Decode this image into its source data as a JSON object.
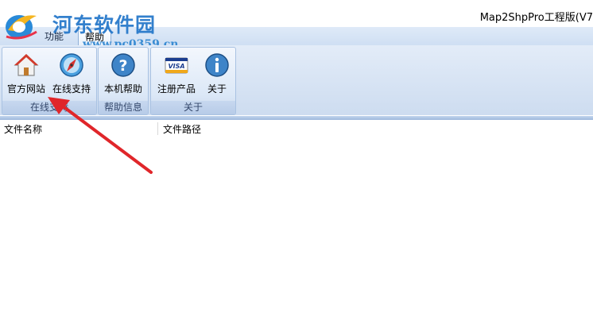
{
  "window": {
    "title": "Map2ShpPro工程版(V7"
  },
  "watermark": {
    "site_name": "河东软件园",
    "url": "www.pc0359.cn"
  },
  "tabs": [
    {
      "label": "功能"
    },
    {
      "label": "帮助",
      "active": true
    }
  ],
  "ribbon": {
    "groups": [
      {
        "label": "在线支持",
        "buttons": [
          {
            "label": "官方网站",
            "icon": "home-icon"
          },
          {
            "label": "在线支持",
            "icon": "compass-icon"
          }
        ]
      },
      {
        "label": "帮助信息",
        "buttons": [
          {
            "label": "本机帮助",
            "icon": "help-icon"
          }
        ]
      },
      {
        "label": "关于",
        "buttons": [
          {
            "label": "注册产品",
            "icon": "visa-card-icon"
          },
          {
            "label": "关于",
            "icon": "info-icon"
          }
        ]
      }
    ]
  },
  "file_list": {
    "columns": [
      "文件名称",
      "文件路径"
    ],
    "rows": []
  },
  "colors": {
    "accent": "#1e73c8",
    "arrow": "#e0262a",
    "ribbon": "#dce8f7"
  }
}
